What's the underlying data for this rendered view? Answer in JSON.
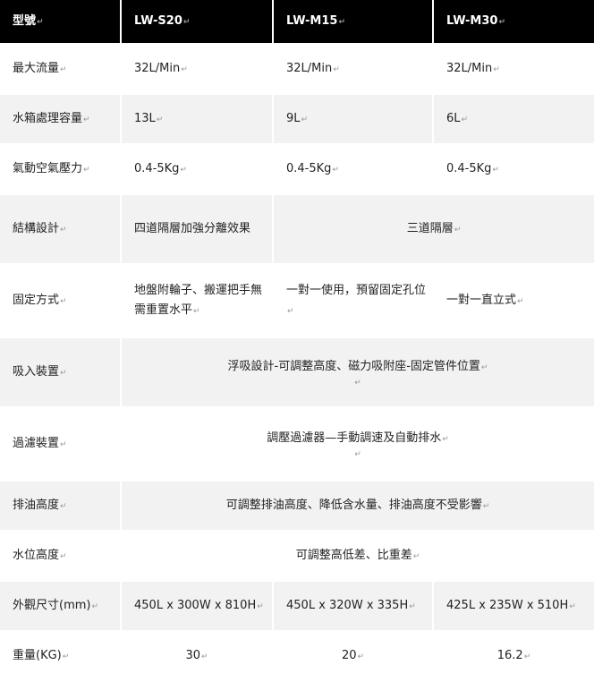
{
  "mark": "↵",
  "header": {
    "label": "型號",
    "models": [
      "LW-S20",
      "LW-M15",
      "LW-M30"
    ]
  },
  "rows": {
    "flow": {
      "label": "最大流量",
      "values": [
        "32L/Min",
        "32L/Min",
        "32L/Min"
      ]
    },
    "tank": {
      "label": "水箱處理容量",
      "values": [
        "13L",
        "9L",
        "6L"
      ]
    },
    "air": {
      "label": "氣動空氣壓力",
      "values": [
        "0.4-5Kg",
        "0.4-5Kg",
        "0.4-5Kg"
      ]
    },
    "structure": {
      "label": "結構設計",
      "s20": "四道隔層加強分離效果",
      "shared": "三道隔層"
    },
    "fixing": {
      "label": "固定方式",
      "values": [
        "地盤附輪子、搬運把手無需重置水平",
        "一對一使用，預留固定孔位",
        "一對一直立式"
      ]
    },
    "suction": {
      "label": "吸入裝置",
      "value": "浮吸設計-可調整高度、磁力吸附座-固定管件位置"
    },
    "filter": {
      "label": "過濾裝置",
      "value": "調壓過濾器—手動調速及自動排水"
    },
    "drain": {
      "label": "排油高度",
      "value": "可調整排油高度、降低含水量、排油高度不受影響"
    },
    "water": {
      "label": "水位高度",
      "value": "可調整高低差、比重差"
    },
    "size": {
      "label": "外觀尺寸(mm)",
      "values": [
        "450L x 300W x 810H",
        "450L x 320W x 335H",
        "425L x 235W x 510H"
      ]
    },
    "weight": {
      "label": "重量(KG)",
      "values": [
        "30",
        "20",
        "16.2"
      ]
    }
  }
}
